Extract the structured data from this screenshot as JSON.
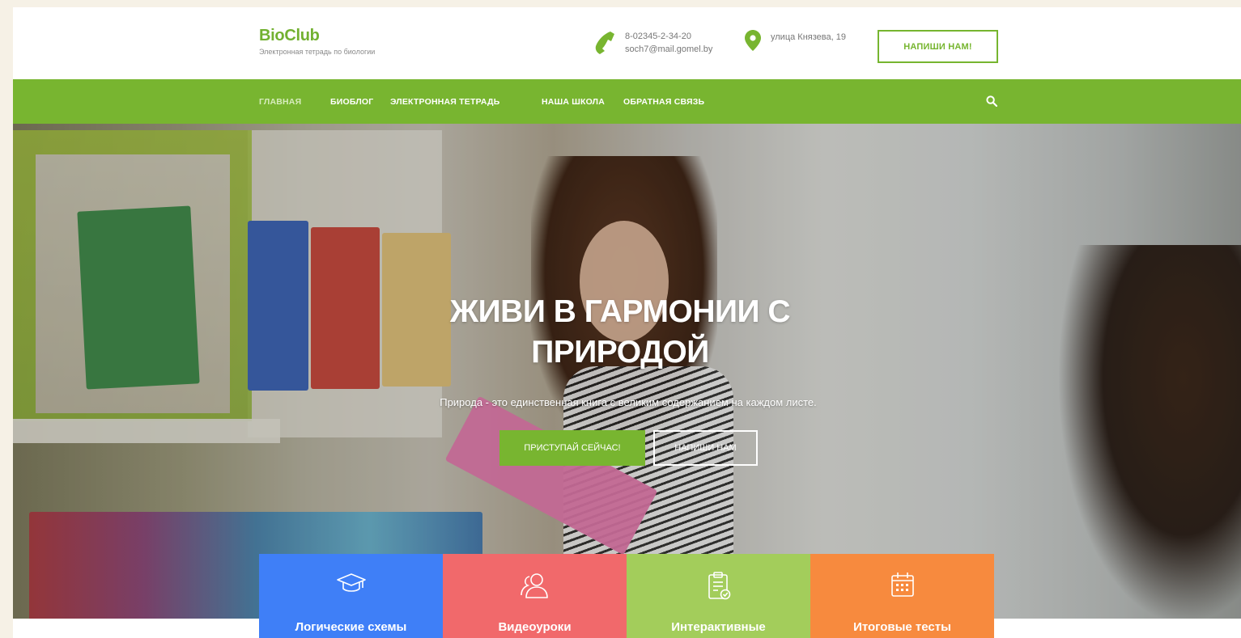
{
  "header": {
    "brand_title": "BioClub",
    "brand_subtitle": "Электронная тетрадь по биологии",
    "phone": "8-02345-2-34-20",
    "email": "soch7@mail.gomel.by",
    "address": "улица Князева, 19",
    "write_button": "НАПИШИ НАМ!"
  },
  "nav": {
    "items": [
      {
        "label": "ГЛАВНАЯ",
        "active": true
      },
      {
        "label": "БИОБЛОГ"
      },
      {
        "label": "ЭЛЕКТРОННАЯ ТЕТРАДЬ"
      },
      {
        "label": "НАША ШКОЛА"
      },
      {
        "label": "ОБРАТНАЯ СВЯЗЬ"
      }
    ],
    "search_icon": "search-icon"
  },
  "hero": {
    "title_line1": "ЖИВИ В ГАРМОНИИ С",
    "title_line2": "ПРИРОДОЙ",
    "subtitle": "Природа - это единственная книга с великим содержанием на каждом листе.",
    "primary_button": "ПРИСТУПАЙ СЕЙЧАС!",
    "secondary_button": "НАПИШИ НАМ"
  },
  "features": [
    {
      "label": "Логические схемы",
      "icon": "graduation-cap-icon",
      "color": "#3f7ff7"
    },
    {
      "label": "Видеоуроки",
      "icon": "users-icon",
      "color": "#f1696b"
    },
    {
      "label": "Интерактивные",
      "icon": "clipboard-check-icon",
      "color": "#a3cd5b"
    },
    {
      "label": "Итоговые тесты",
      "icon": "calendar-icon",
      "color": "#f78a3e"
    }
  ],
  "colors": {
    "accent_green": "#78b530",
    "nav_bg": "#78b530"
  }
}
